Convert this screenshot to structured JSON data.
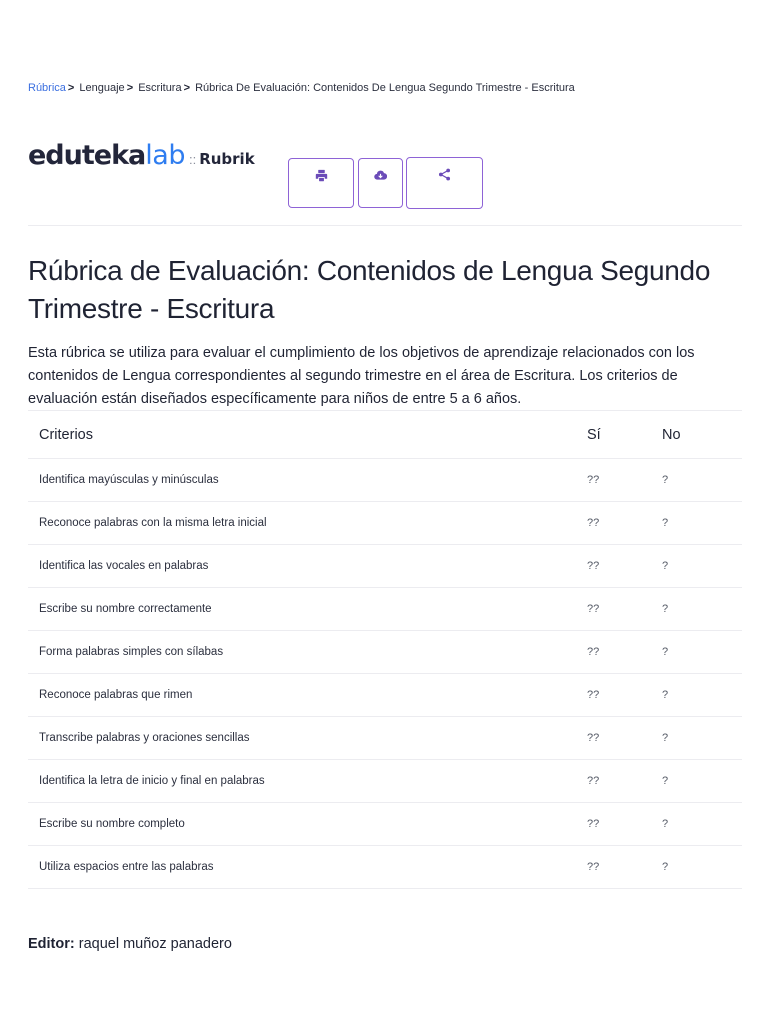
{
  "breadcrumb": {
    "items": [
      "Rúbrica",
      "Lenguaje",
      "Escritura",
      "Rúbrica De Evaluación: Contenidos De Lengua Segundo Trimestre - Escritura"
    ],
    "separator": ">"
  },
  "logo": {
    "part1": "eduteka",
    "part2": "lab",
    "separator": "::",
    "product": "Rubrik"
  },
  "actions": {
    "icons": [
      "print-icon",
      "cloud-download-icon",
      "share-icon"
    ]
  },
  "title": "Rúbrica de Evaluación: Contenidos de Lengua Segundo Trimestre - Escritura",
  "description": "Esta rúbrica se utiliza para evaluar el cumplimiento de los objetivos de aprendizaje relacionados con los contenidos de Lengua correspondientes al segundo trimestre en el área de Escritura. Los criterios de evaluación están diseñados específicamente para niños de entre 5 a 6 años.",
  "table": {
    "headers": [
      "Criterios",
      "Sí",
      "No"
    ],
    "rows": [
      [
        "Identifica mayúsculas y minúsculas",
        "??",
        "?"
      ],
      [
        "Reconoce palabras con la misma letra inicial",
        "??",
        "?"
      ],
      [
        "Identifica las vocales en palabras",
        "??",
        "?"
      ],
      [
        "Escribe su nombre correctamente",
        "??",
        "?"
      ],
      [
        "Forma palabras simples con sílabas",
        "??",
        "?"
      ],
      [
        "Reconoce palabras que rimen",
        "??",
        "?"
      ],
      [
        "Transcribe palabras y oraciones sencillas",
        "??",
        "?"
      ],
      [
        "Identifica la letra de inicio y final en palabras",
        "??",
        "?"
      ],
      [
        "Escribe su nombre completo",
        "??",
        "?"
      ],
      [
        "Utiliza espacios entre las palabras",
        "??",
        "?"
      ]
    ]
  },
  "editor": {
    "label": "Editor:",
    "name": "raquel muñoz panadero"
  },
  "colors": {
    "accent": "#8e63d6",
    "link": "#3b6fe0",
    "logo_blue": "#2f7df0",
    "text": "#1f2333"
  }
}
